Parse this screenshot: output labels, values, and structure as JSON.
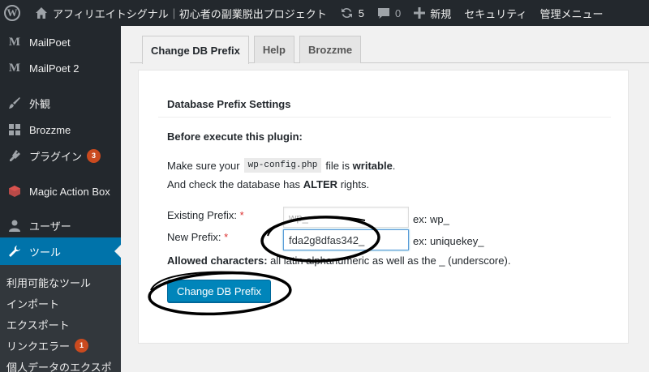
{
  "adminbar": {
    "site_name": "アフィリエイトシグナル｜初心者の副業脱出プロジェクト",
    "updates_count": "5",
    "comments_count": "0",
    "new_label": "新規",
    "security_label": "セキュリティ",
    "admin_menu_label": "管理メニュー"
  },
  "sidebar": {
    "items": [
      {
        "label": "MailPoet",
        "icon": "mailpoet-icon"
      },
      {
        "label": "MailPoet 2",
        "icon": "mailpoet-icon"
      },
      {
        "label": "外観",
        "icon": "brush-icon"
      },
      {
        "label": "Brozzme",
        "icon": "grid-icon"
      },
      {
        "label": "プラグイン",
        "icon": "plugin-icon",
        "badge": "3"
      },
      {
        "label": "Magic Action Box",
        "icon": "box-icon"
      },
      {
        "label": "ユーザー",
        "icon": "user-icon"
      },
      {
        "label": "ツール",
        "icon": "wrench-icon",
        "current": true
      }
    ],
    "submenu": [
      {
        "label": "利用可能なツール"
      },
      {
        "label": "インポート"
      },
      {
        "label": "エクスポート"
      },
      {
        "label": "リンクエラー",
        "badge": "1"
      },
      {
        "label": "個人データのエクスポ"
      }
    ]
  },
  "tabs": [
    "Change DB Prefix",
    "Help",
    "Brozzme"
  ],
  "panel": {
    "title": "Database Prefix Settings",
    "before_heading": "Before execute this plugin:",
    "line1_prefix": "Make sure your",
    "line1_code": "wp-config.php",
    "line1_mid": "file is",
    "line1_bold": "writable",
    "line1_end": ".",
    "line2_prefix": "And check the database has",
    "line2_bold": "ALTER",
    "line2_end": "rights.",
    "existing_label": "Existing Prefix:",
    "existing_value": "wp_",
    "existing_example": "ex: wp_",
    "new_label": "New Prefix:",
    "new_value": "fda2g8dfas342_",
    "new_example": "ex: uniquekey_",
    "required_mark": "*",
    "allowed_bold": "Allowed characters:",
    "allowed_text": "all latin alphanumeric as well as the _ (underscore).",
    "button_label": "Change DB Prefix"
  },
  "colors": {
    "adminbar_bg": "#23282d",
    "sidebar_current": "#0073aa",
    "button_primary": "#0085ba",
    "badge": "#ca4a1f",
    "required": "#dc3232"
  }
}
